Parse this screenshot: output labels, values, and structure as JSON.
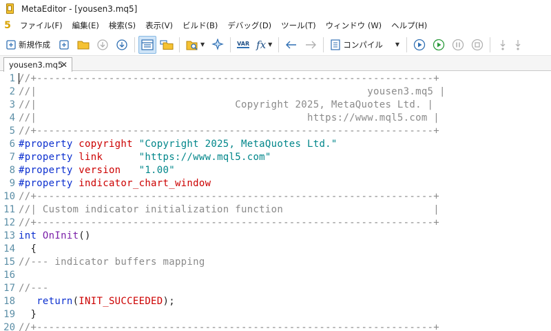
{
  "window": {
    "title": "MetaEditor - [yousen3.mq5]"
  },
  "menu": {
    "logo": "5",
    "items": [
      "ファイル(F)",
      "編集(E)",
      "検索(S)",
      "表示(V)",
      "ビルド(B)",
      "デバッグ(D)",
      "ツール(T)",
      "ウィンドウ (W)",
      "ヘルプ(H)"
    ]
  },
  "toolbar": {
    "new_label": "新規作成",
    "compile_label": "コンパイル",
    "var_label": "VAR",
    "fx_label": "fx"
  },
  "tabs": [
    {
      "label": "yousen3.mq5",
      "close": "✕"
    }
  ],
  "editor": {
    "lines": [
      {
        "n": "1",
        "parts": [
          {
            "t": "//+------------------------------------------------------------------+",
            "c": "comment"
          }
        ]
      },
      {
        "n": "2",
        "parts": [
          {
            "t": "//|                                                       yousen3.mq5 |",
            "c": "comment"
          }
        ]
      },
      {
        "n": "3",
        "parts": [
          {
            "t": "//|                                 Copyright 2025, MetaQuotes Ltd. |",
            "c": "comment"
          }
        ]
      },
      {
        "n": "4",
        "parts": [
          {
            "t": "//|                                             https://www.mql5.com |",
            "c": "comment"
          }
        ]
      },
      {
        "n": "5",
        "parts": [
          {
            "t": "//+------------------------------------------------------------------+",
            "c": "comment"
          }
        ]
      },
      {
        "n": "6",
        "parts": [
          {
            "t": "#property ",
            "c": "prep"
          },
          {
            "t": "copyright ",
            "c": "prop"
          },
          {
            "t": "\"Copyright 2025, MetaQuotes Ltd.\"",
            "c": "str"
          }
        ]
      },
      {
        "n": "7",
        "parts": [
          {
            "t": "#property ",
            "c": "prep"
          },
          {
            "t": "link      ",
            "c": "prop"
          },
          {
            "t": "\"https://www.mql5.com\"",
            "c": "str"
          }
        ]
      },
      {
        "n": "8",
        "parts": [
          {
            "t": "#property ",
            "c": "prep"
          },
          {
            "t": "version   ",
            "c": "prop"
          },
          {
            "t": "\"1.00\"",
            "c": "str"
          }
        ]
      },
      {
        "n": "9",
        "parts": [
          {
            "t": "#property ",
            "c": "prep"
          },
          {
            "t": "indicator_chart_window",
            "c": "prop"
          }
        ]
      },
      {
        "n": "10",
        "parts": [
          {
            "t": "//+------------------------------------------------------------------+",
            "c": "comment"
          }
        ]
      },
      {
        "n": "11",
        "parts": [
          {
            "t": "//| Custom indicator initialization function                         |",
            "c": "comment"
          }
        ]
      },
      {
        "n": "12",
        "parts": [
          {
            "t": "//+------------------------------------------------------------------+",
            "c": "comment"
          }
        ]
      },
      {
        "n": "13",
        "parts": [
          {
            "t": "int ",
            "c": "kw"
          },
          {
            "t": "OnInit",
            "c": "fn"
          },
          {
            "t": "()",
            "c": "plain"
          }
        ]
      },
      {
        "n": "14",
        "parts": [
          {
            "t": "  {",
            "c": "plain"
          }
        ]
      },
      {
        "n": "15",
        "parts": [
          {
            "t": "//--- indicator buffers mapping",
            "c": "comment"
          }
        ]
      },
      {
        "n": "16",
        "parts": [
          {
            "t": "",
            "c": "plain"
          }
        ]
      },
      {
        "n": "17",
        "parts": [
          {
            "t": "//---",
            "c": "comment"
          }
        ]
      },
      {
        "n": "18",
        "parts": [
          {
            "t": "   ",
            "c": "plain"
          },
          {
            "t": "return",
            "c": "kw"
          },
          {
            "t": "(",
            "c": "plain"
          },
          {
            "t": "INIT_SUCCEEDED",
            "c": "const"
          },
          {
            "t": ");",
            "c": "plain"
          }
        ]
      },
      {
        "n": "19",
        "parts": [
          {
            "t": "  }",
            "c": "plain"
          }
        ]
      },
      {
        "n": "20",
        "parts": [
          {
            "t": "//+------------------------------------------------------------------+",
            "c": "comment"
          }
        ]
      }
    ]
  },
  "colors": {
    "comment": "#8a8a8a",
    "preprocessor": "#0b2fcf",
    "property": "#cc0000",
    "string": "#00868a",
    "function": "#7a1fa8",
    "line_number": "#5b8ea6"
  }
}
